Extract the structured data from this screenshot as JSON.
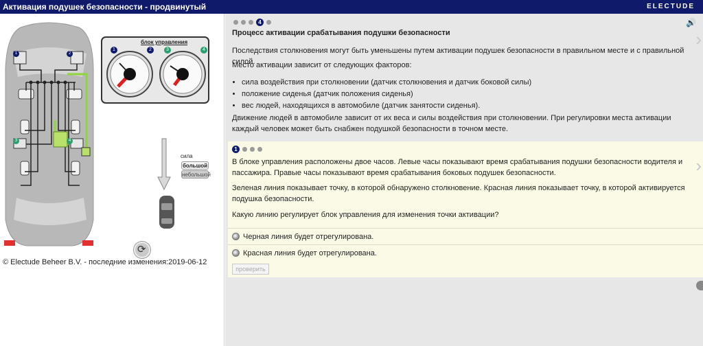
{
  "window": {
    "title": "Активация подушек безопасности - продвинутый",
    "brand": "ELECTUDE"
  },
  "left": {
    "control_unit_label": "блок управления",
    "gauge_numbers": [
      "1",
      "2",
      "3",
      "4"
    ],
    "diagram_numbers": [
      "1",
      "2",
      "3",
      "4"
    ],
    "force_label": "сила",
    "force_high": "большой",
    "force_low": "небольшой",
    "copyright": "© Electude Beheer B.V. - последние изменения:2019-06-12"
  },
  "right": {
    "page_dot_active": "4",
    "title": "Процесс активации срабатывания подушки безопасности",
    "p1": "Последствия столкновения могут быть уменьшены путем активации подушек безопасности в правильном месте и с правильной силой.",
    "p2": "Место активации зависит от следующих факторов:",
    "bullets": [
      "сила воздействия при столкновении (датчик столкновения и датчик боковой силы)",
      "положение сиденья (датчик положения сиденья)",
      "вес людей, находящихся в автомобиле (датчик занятости сиденья)."
    ],
    "p3": "Движение людей в автомобиле зависит от их веса и силы воздействия при столкновении. При регулировки места активации каждый человек может быть снабжен подушкой безопасности в точном месте.",
    "question": {
      "dot_active": "1",
      "q1": "В блоке управления расположены двое часов. Левые часы показывают время срабатывания подушки безопасности водителя и пассажира. Правые часы показывают время срабатывания боковых подушек безопасности.",
      "q2": "Зеленая линия показывает точку, в которой обнаружено столкновение. Красная линия показывает точку, в которой активируется подушка безопасности.",
      "q3": "Какую линию регулирует блок управления для изменения точки активации?",
      "options": [
        "Черная линия будет отрегулирована.",
        "Красная линия будет отрегулирована."
      ],
      "check_label": "проверить"
    }
  }
}
